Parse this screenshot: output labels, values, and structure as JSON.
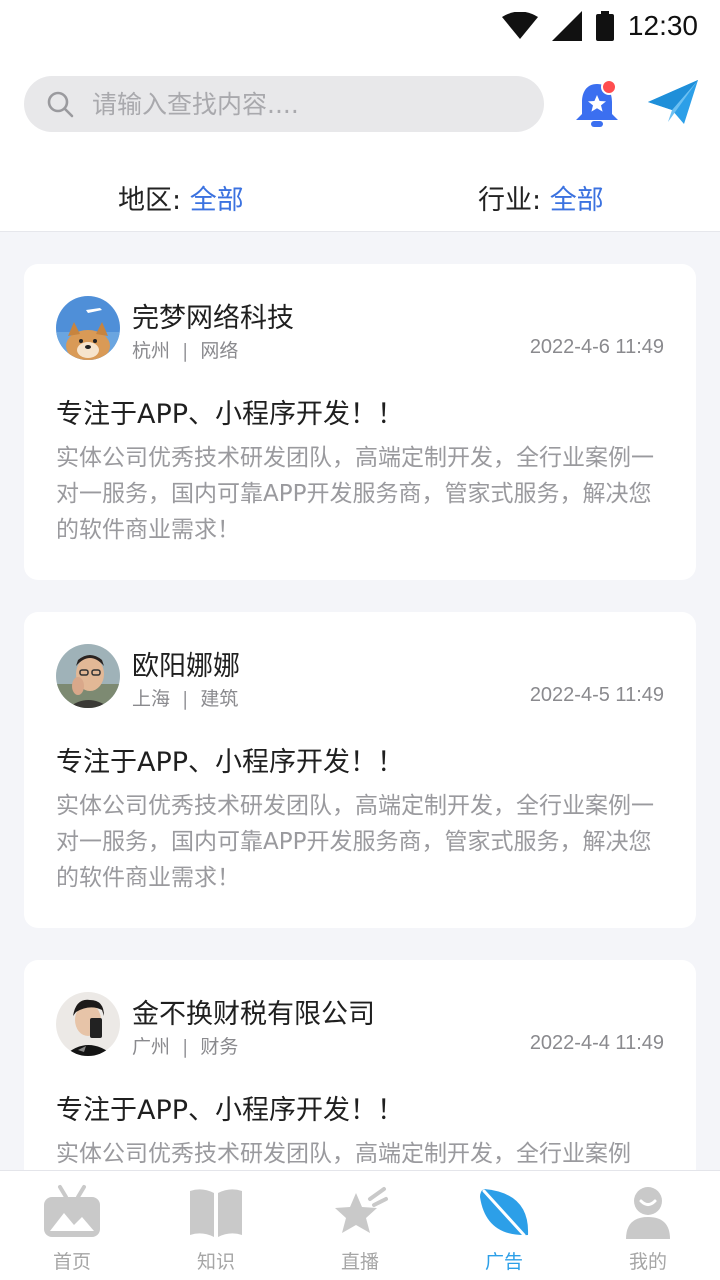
{
  "status_bar": {
    "time": "12:30"
  },
  "search": {
    "placeholder": "请输入查找内容...."
  },
  "filters": {
    "region": {
      "label": "地区: ",
      "value": "全部"
    },
    "industry": {
      "label": "行业: ",
      "value": "全部"
    }
  },
  "posts": [
    {
      "company": "完梦网络科技",
      "city": "杭州",
      "separator": "|",
      "industry": "网络",
      "date": "2022-4-6 11:49",
      "headline": "专注于APP、小程序开发！！",
      "description": "实体公司优秀技术研发团队，高端定制开发，全行业案例一对一服务，国内可靠APP开发服务商，管家式服务，解决您的软件商业需求！"
    },
    {
      "company": "欧阳娜娜",
      "city": "上海",
      "separator": "|",
      "industry": "建筑",
      "date": "2022-4-5 11:49",
      "headline": "专注于APP、小程序开发！！",
      "description": "实体公司优秀技术研发团队，高端定制开发，全行业案例一对一服务，国内可靠APP开发服务商，管家式服务，解决您的软件商业需求！"
    },
    {
      "company": "金不换财税有限公司",
      "city": "广州",
      "separator": "|",
      "industry": "财务",
      "date": "2022-4-4 11:49",
      "headline": "专注于APP、小程序开发！！",
      "description": "实体公司优秀技术研发团队，高端定制开发，全行业案例"
    }
  ],
  "tabs": [
    {
      "label": "首页",
      "icon": "home-tv-icon",
      "active": false
    },
    {
      "label": "知识",
      "icon": "book-icon",
      "active": false
    },
    {
      "label": "直播",
      "icon": "star-live-icon",
      "active": false
    },
    {
      "label": "广告",
      "icon": "leaf-icon",
      "active": true
    },
    {
      "label": "我的",
      "icon": "user-icon",
      "active": false
    }
  ],
  "colors": {
    "accent": "#3b72e0",
    "tab_active": "#2c9fe8",
    "bell": "#3b6ff0",
    "badge": "#ff4d4f",
    "send": "#2c9fe8"
  }
}
